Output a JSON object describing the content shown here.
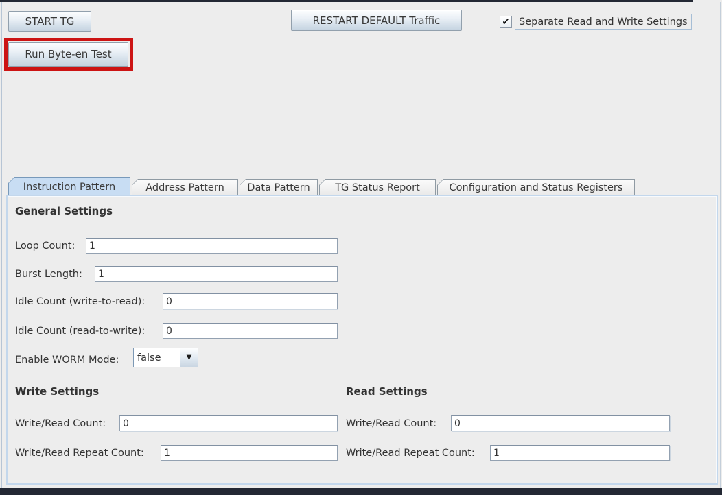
{
  "window": {
    "background": "#ededed",
    "frame_color": "#232834",
    "highlight_color": "#cc1414"
  },
  "icons": {
    "checkmark": "✔",
    "dropdown_arrow": "▼"
  },
  "toolbar": {
    "start_button": "START TG",
    "restart_button": "RESTART DEFAULT Traffic",
    "byteen_button": "Run Byte-en Test",
    "separate_checkbox_label": "Separate Read and Write Settings",
    "separate_checkbox_checked": "true"
  },
  "tabs": {
    "selected": "Instruction Pattern",
    "items": [
      {
        "label": "Instruction Pattern"
      },
      {
        "label": "Address Pattern"
      },
      {
        "label": "Data Pattern"
      },
      {
        "label": "TG Status Report"
      },
      {
        "label": "Configuration and Status Registers"
      }
    ]
  },
  "panel": {
    "general": {
      "title": "General Settings",
      "fields": [
        {
          "label": "Loop Count:",
          "value": "1"
        },
        {
          "label": "Burst Length:",
          "value": "1"
        },
        {
          "label": "Idle Count (write-to-read):",
          "value": "0"
        },
        {
          "label": "Idle Count (read-to-write):",
          "value": "0"
        }
      ]
    },
    "worm": {
      "label": "Enable WORM Mode:",
      "value": "false"
    },
    "write": {
      "title": "Write Settings",
      "fields": [
        {
          "label": "Write/Read Count:",
          "value": "0"
        },
        {
          "label": "Write/Read Repeat Count:",
          "value": "1"
        }
      ]
    },
    "read": {
      "title": "Read Settings",
      "fields": [
        {
          "label": "Write/Read Count:",
          "value": "0"
        },
        {
          "label": "Write/Read Repeat Count:",
          "value": "1"
        }
      ]
    }
  }
}
